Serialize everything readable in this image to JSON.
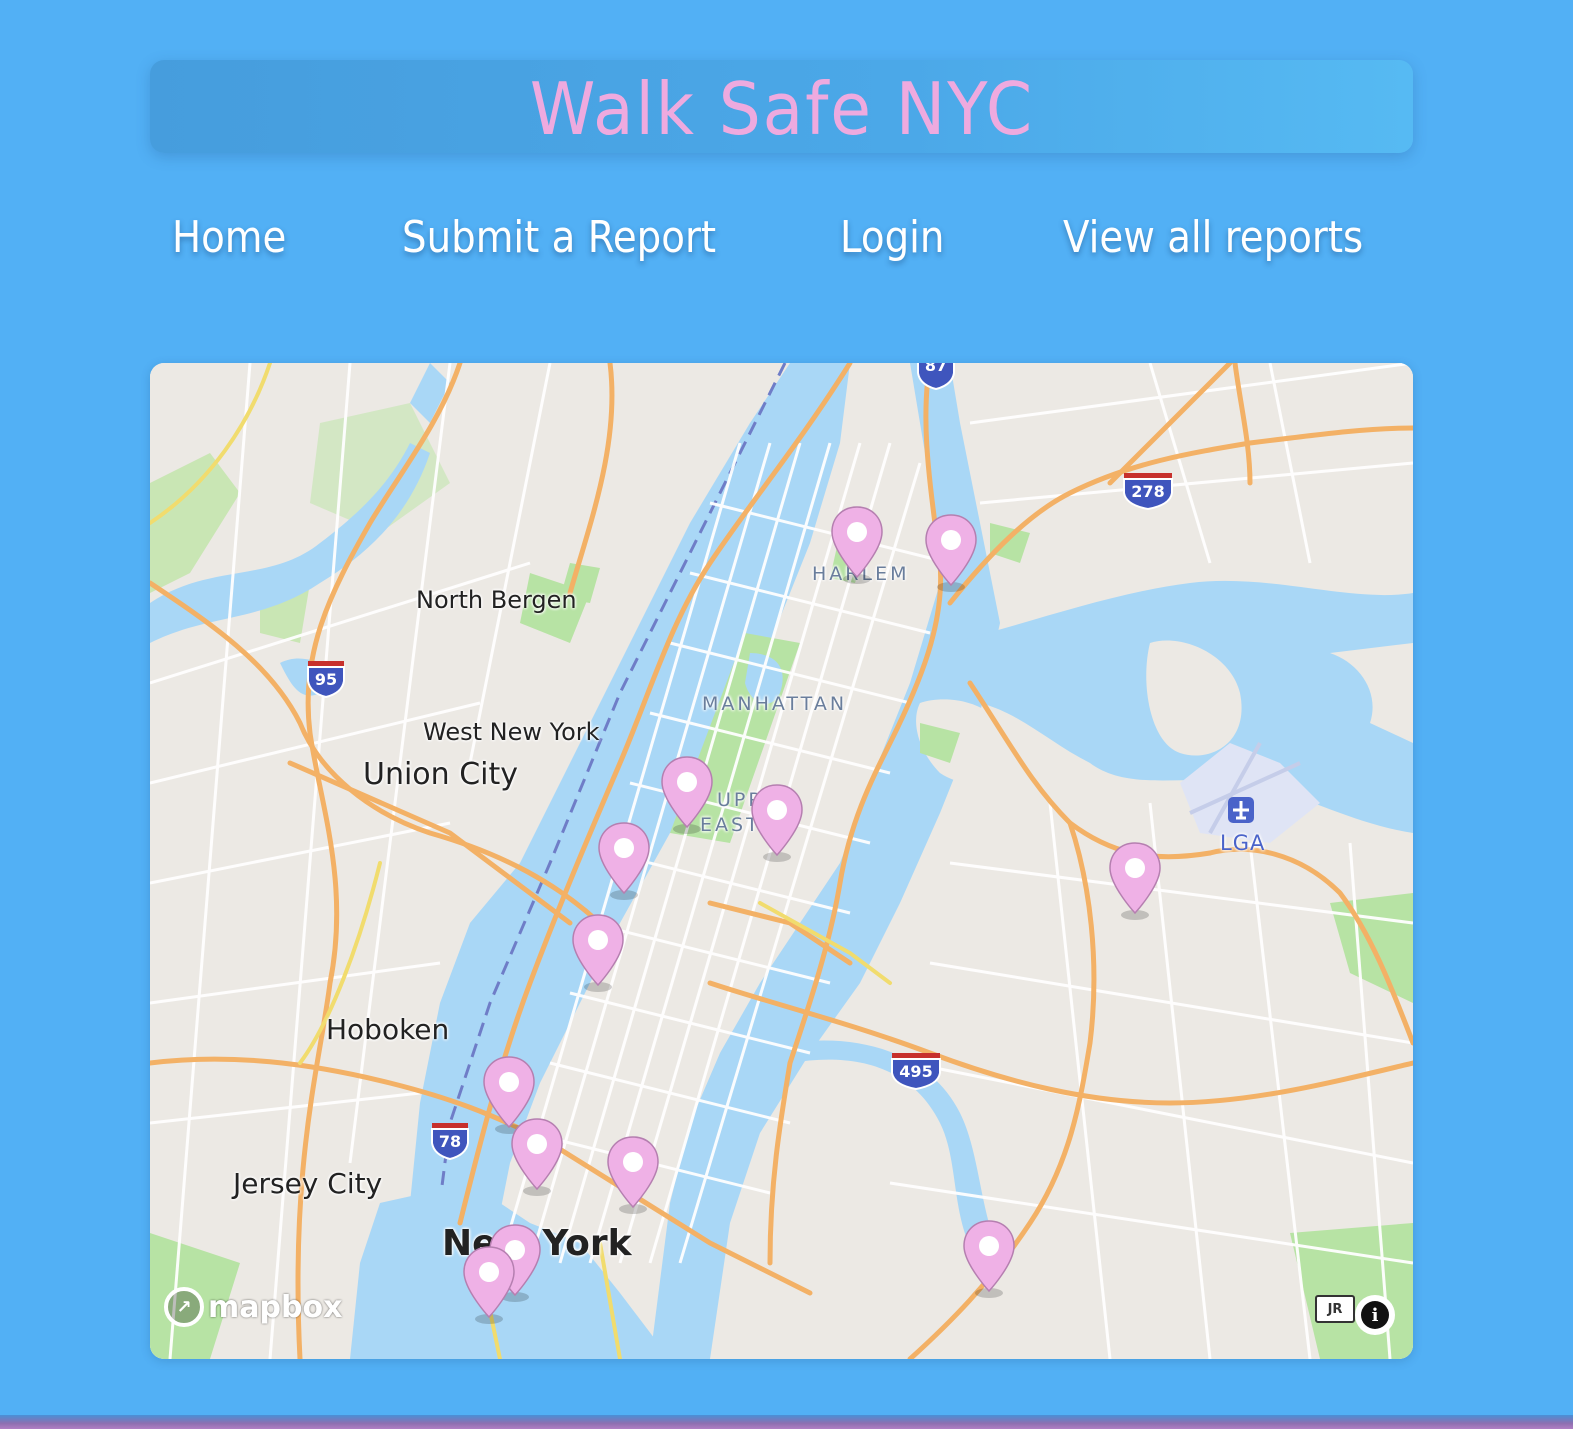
{
  "header": {
    "title": "Walk Safe NYC"
  },
  "nav": {
    "items": [
      {
        "label": "Home"
      },
      {
        "label": "Submit a Report"
      },
      {
        "label": "Login"
      },
      {
        "label": "View all reports"
      }
    ]
  },
  "map": {
    "places": {
      "north_bergen": "North Bergen",
      "west_new_york": "West New York",
      "union_city": "Union City",
      "hoboken": "Hoboken",
      "jersey_city": "Jersey City",
      "new_york": "New York",
      "harlem": "HARLEM",
      "manhattan": "MANHATTAN",
      "upper_east_side_1": "UPP",
      "upper_east_side_2": "EAST",
      "lga": "LGA"
    },
    "highway_shields": [
      "87",
      "278",
      "95",
      "495",
      "78"
    ],
    "attribution_logo": "mapbox",
    "attribution_button": "i",
    "corner_badge": "JR",
    "report_pins": {
      "count": 14,
      "color": "#efb1e6"
    }
  },
  "colors": {
    "page_background": "#52b0f5",
    "title_color": "#eeaadf",
    "nav_text": "#ffffff",
    "water": "#a9d7f6",
    "land": "#ece9e4",
    "park": "#b7e3a4",
    "highway": "#f3b166"
  }
}
